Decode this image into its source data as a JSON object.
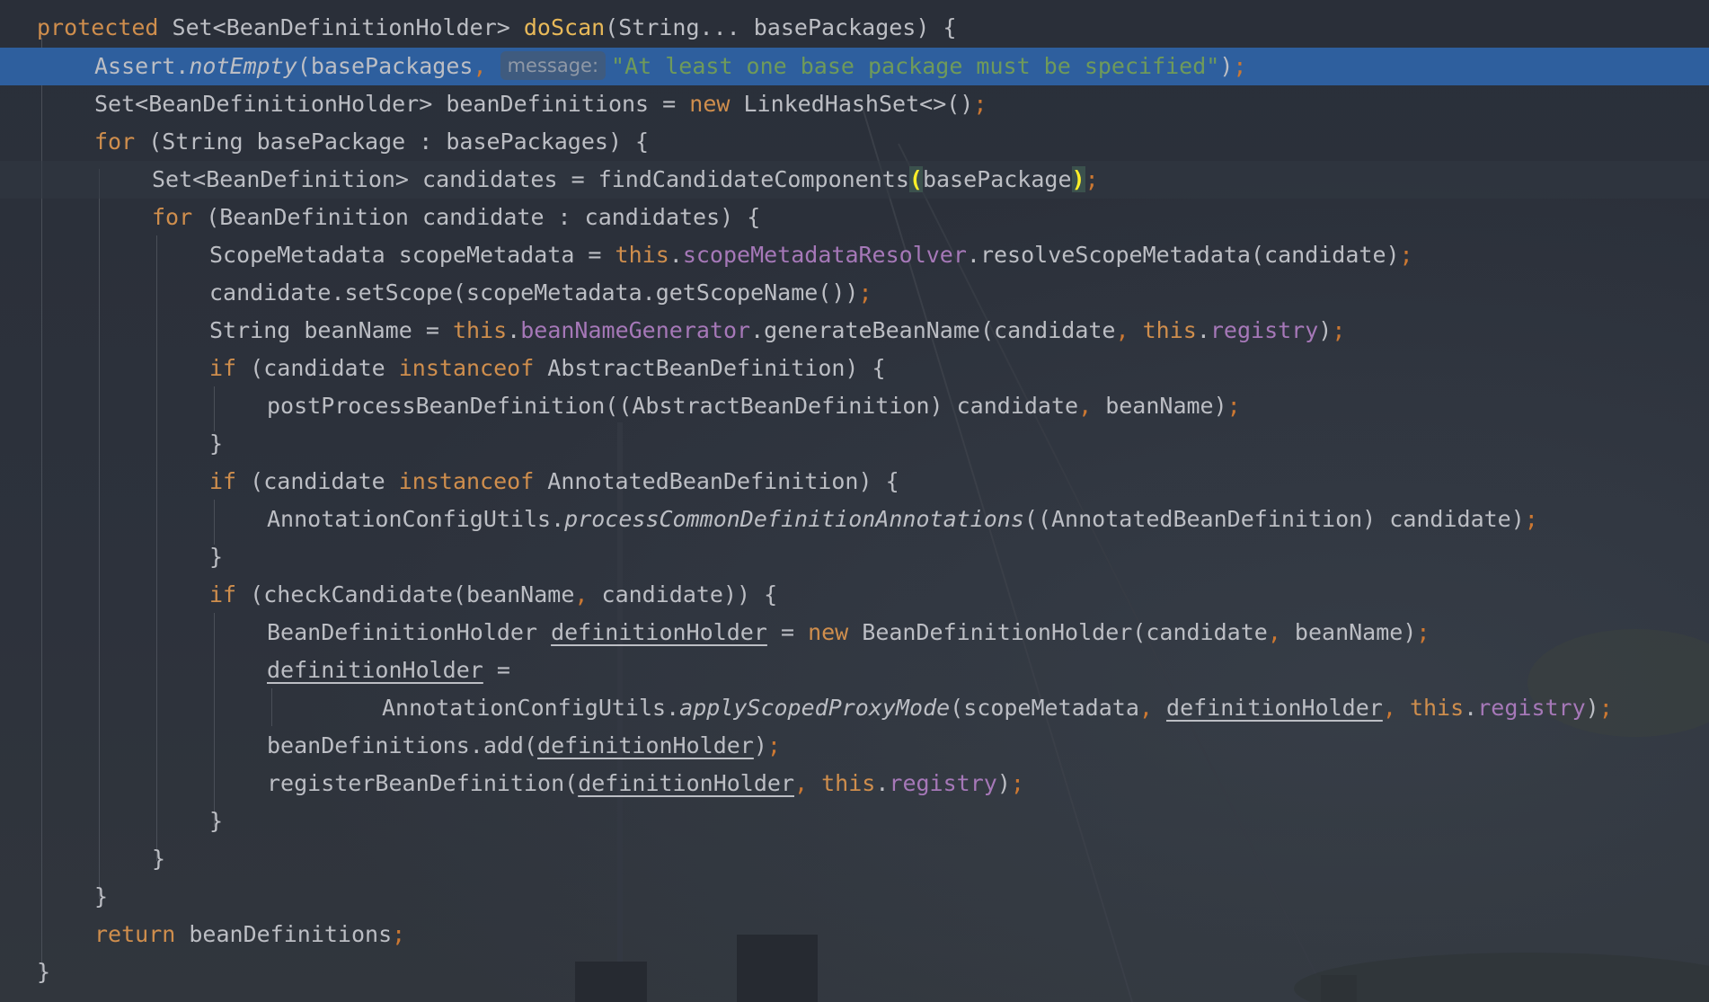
{
  "editor": {
    "language": "java",
    "method_signature": {
      "modifier": "protected",
      "return_type": "Set<BeanDefinitionHolder>",
      "name": "doScan",
      "params": "(String... basePackages) {"
    },
    "hint_label": "message:",
    "lines": [
      {
        "t": "kw",
        "v": "protected"
      },
      {
        "t": "plain",
        "v": " Set<BeanDefinitionHolder> "
      }
    ]
  },
  "code": {
    "l1_kw": "protected",
    "l1_type": " Set<BeanDefinitionHolder> ",
    "l1_fn": "doScan",
    "l1_rest": "(String... basePackages) {",
    "l2_a": "Assert.",
    "l2_fn": "notEmpty",
    "l2_b": "(basePackages",
    "l2_comma": ",",
    "l2_hint": "message:",
    "l2_str": "\"At least one base package must be specified\"",
    "l2_end": ")",
    "l2_semi": ";",
    "l3_a": "Set<BeanDefinitionHolder> beanDefinitions = ",
    "l3_kw": "new",
    "l3_b": " LinkedHashSet<>()",
    "l3_semi": ";",
    "l4_kw": "for",
    "l4_rest": " (String basePackage : basePackages) {",
    "l5_a": "Set<BeanDefinition> candidates = findCandidateComponents",
    "l5_open": "(",
    "l5_b": "basePackage",
    "l5_close": ")",
    "l5_semi": ";",
    "l6_kw": "for",
    "l6_rest": " (BeanDefinition candidate : candidates) {",
    "l7_a": "ScopeMetadata scopeMetadata = ",
    "l7_kw": "this",
    "l7_dot": ".",
    "l7_fld": "scopeMetadataResolver",
    "l7_b": ".resolveScopeMetadata(candidate)",
    "l7_semi": ";",
    "l8_a": "candidate.setScope(scopeMetadata.getScopeName())",
    "l8_semi": ";",
    "l9_a": "String beanName = ",
    "l9_kw": "this",
    "l9_dot": ".",
    "l9_fld": "beanNameGenerator",
    "l9_b": ".generateBeanName(candidate",
    "l9_comma": ",",
    "l9_kw2": " this",
    "l9_dot2": ".",
    "l9_fld2": "registry",
    "l9_end": ")",
    "l9_semi": ";",
    "l10_kw": "if",
    "l10_a": " (candidate ",
    "l10_kw2": "instanceof",
    "l10_b": " AbstractBeanDefinition) {",
    "l11_a": "postProcessBeanDefinition((AbstractBeanDefinition) candidate",
    "l11_comma": ",",
    "l11_b": " beanName)",
    "l11_semi": ";",
    "l12_a": "}",
    "l13_kw": "if",
    "l13_a": " (candidate ",
    "l13_kw2": "instanceof",
    "l13_b": " AnnotatedBeanDefinition) {",
    "l14_a": "AnnotationConfigUtils.",
    "l14_fn": "processCommonDefinitionAnnotations",
    "l14_b": "((AnnotatedBeanDefinition) candidate)",
    "l14_semi": ";",
    "l15_a": "}",
    "l16_kw": "if",
    "l16_a": " (checkCandidate(beanName",
    "l16_comma": ",",
    "l16_b": " candidate)) {",
    "l17_a": "BeanDefinitionHolder ",
    "l17_var": "definitionHolder",
    "l17_b": " = ",
    "l17_kw": "new",
    "l17_c": " BeanDefinitionHolder(candidate",
    "l17_comma": ",",
    "l17_d": " beanName)",
    "l17_semi": ";",
    "l18_var": "definitionHolder",
    "l18_b": " =",
    "l19_a": "AnnotationConfigUtils.",
    "l19_fn": "applyScopedProxyMode",
    "l19_b": "(scopeMetadata",
    "l19_comma": ",",
    "l19_sp": " ",
    "l19_var": "definitionHolder",
    "l19_comma2": ",",
    "l19_kw": " this",
    "l19_dot": ".",
    "l19_fld": "registry",
    "l19_end": ")",
    "l19_semi": ";",
    "l20_a": "beanDefinitions.add(",
    "l20_var": "definitionHolder",
    "l20_end": ")",
    "l20_semi": ";",
    "l21_a": "registerBeanDefinition(",
    "l21_var": "definitionHolder",
    "l21_comma": ",",
    "l21_kw": " this",
    "l21_dot": ".",
    "l21_fld": "registry",
    "l21_end": ")",
    "l21_semi": ";",
    "l22_a": "}",
    "l23_a": "}",
    "l24_a": "}",
    "l25_kw": "return",
    "l25_a": " beanDefinitions",
    "l25_semi": ";",
    "l26_a": "}"
  },
  "colors": {
    "background": "#2b303a",
    "keyword": "#cf8e4d",
    "method_decl": "#e8b959",
    "field": "#a678b8",
    "string": "#6f9a5a",
    "plain": "#bcbec4",
    "selection": "#2e5f9e"
  }
}
